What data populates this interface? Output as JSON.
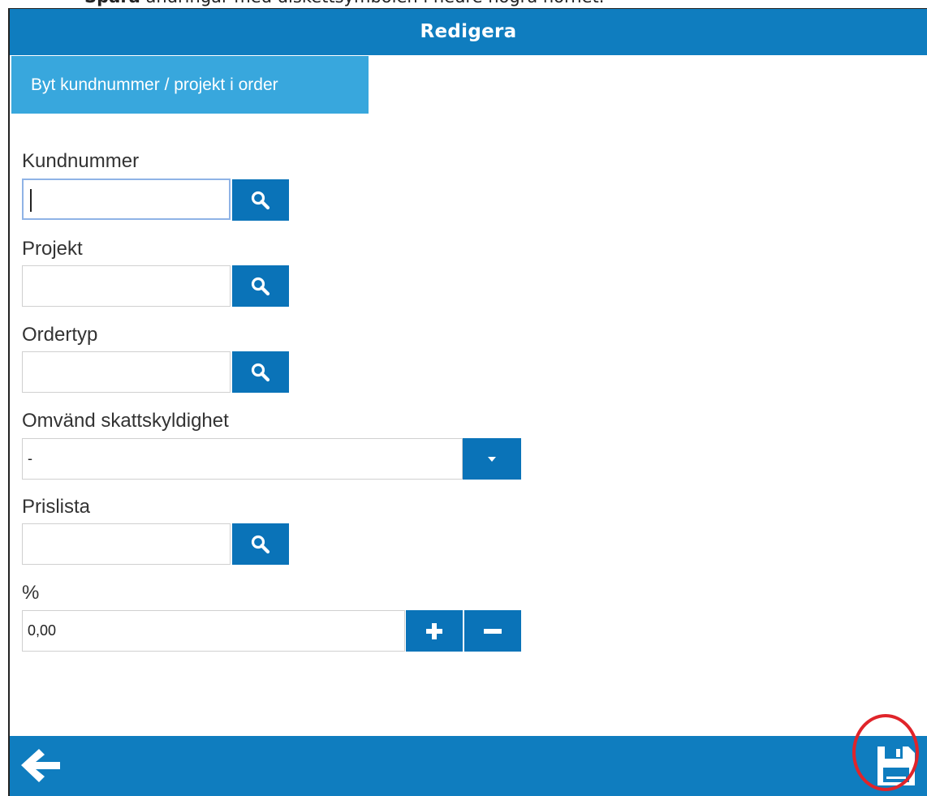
{
  "instruction": {
    "bold": "Spara",
    "text": " ändringar med diskettsymbolen i nedre högra hörnet."
  },
  "header": {
    "title": "Redigera"
  },
  "tab": {
    "label": "Byt kundnummer / projekt i order"
  },
  "form": {
    "kundnummer": {
      "label": "Kundnummer",
      "value": ""
    },
    "projekt": {
      "label": "Projekt",
      "value": ""
    },
    "ordertyp": {
      "label": "Ordertyp",
      "value": ""
    },
    "omvand": {
      "label": "Omvänd skattskyldighet",
      "value": "-"
    },
    "prislista": {
      "label": "Prislista",
      "value": ""
    },
    "procent": {
      "label": "%",
      "value": "0,00"
    }
  },
  "icons": {
    "search": "search-icon",
    "dropdown": "chevron-down-icon",
    "plus": "plus-icon",
    "minus": "minus-icon",
    "back": "arrow-left-icon",
    "save": "floppy-disk-icon"
  },
  "colors": {
    "header": "#0f7dbf",
    "tab": "#38a7dd",
    "button": "#0a73b8",
    "highlight": "#e0242a"
  }
}
